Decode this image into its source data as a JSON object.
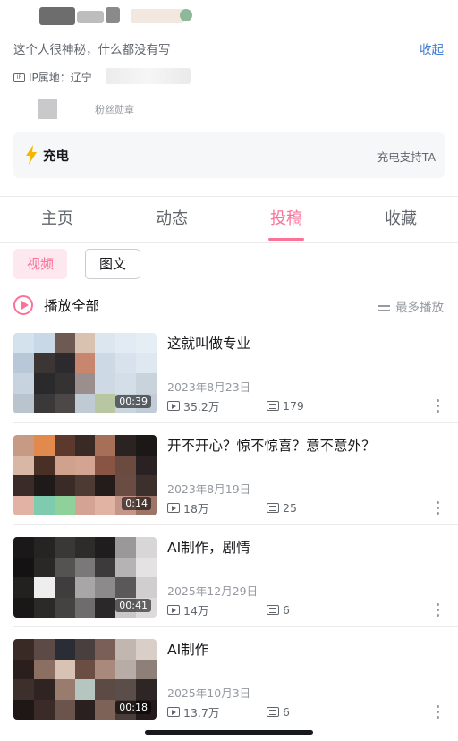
{
  "profile": {
    "bio": "这个人很神秘，什么都没有写",
    "collapse_label": "收起",
    "ip_label": "IP属地：辽宁",
    "fans_badge_label": "粉丝勋章"
  },
  "charge": {
    "title": "充电",
    "action": "充电支持TA"
  },
  "tabs": [
    {
      "label": "主页",
      "active": false
    },
    {
      "label": "动态",
      "active": false
    },
    {
      "label": "投稿",
      "active": true
    },
    {
      "label": "收藏",
      "active": false
    }
  ],
  "filters": [
    {
      "label": "视频",
      "selected": true
    },
    {
      "label": "图文",
      "selected": false
    }
  ],
  "playall": {
    "label": "播放全部",
    "sort_label": "最多播放"
  },
  "videos": [
    {
      "title": "这就叫做专业",
      "date": "2023年8月23日",
      "views": "35.2万",
      "danmaku": "179",
      "duration": "00:39"
    },
    {
      "title": "开不开心？惊不惊喜？意不意外？",
      "date": "2023年8月19日",
      "views": "18万",
      "danmaku": "25",
      "duration": "0:14"
    },
    {
      "title": "AI制作，剧情",
      "date": "2025年12月29日",
      "views": "14万",
      "danmaku": "6",
      "duration": "00:41"
    },
    {
      "title": "AI制作",
      "date": "2025年10月3日",
      "views": "13.7万",
      "danmaku": "6",
      "duration": "00:18"
    }
  ],
  "colors": {
    "accent": "#fb7299",
    "link": "#3a7bd5",
    "charge_icon": "#f8b500"
  }
}
